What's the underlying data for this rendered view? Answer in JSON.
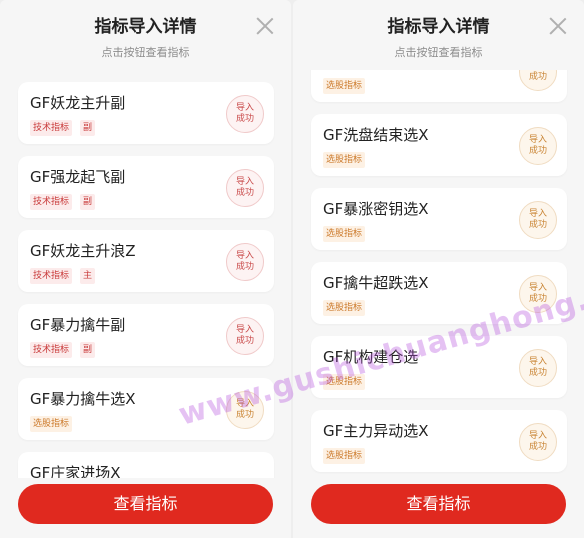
{
  "left": {
    "title": "指标导入详情",
    "subtitle": "点击按钮查看指标",
    "items": [
      {
        "name": "GF妖龙主升副",
        "tags": [
          "技术指标",
          "副"
        ],
        "tag_color": "red",
        "status": [
          "导入",
          "成功"
        ]
      },
      {
        "name": "GF强龙起飞副",
        "tags": [
          "技术指标",
          "副"
        ],
        "tag_color": "red",
        "status": [
          "导入",
          "成功"
        ]
      },
      {
        "name": "GF妖龙主升浪Z",
        "tags": [
          "技术指标",
          "主"
        ],
        "tag_color": "red",
        "status": [
          "导入",
          "成功"
        ]
      },
      {
        "name": "GF暴力擒牛副",
        "tags": [
          "技术指标",
          "副"
        ],
        "tag_color": "red",
        "status": [
          "导入",
          "成功"
        ]
      },
      {
        "name": "GF暴力擒牛选X",
        "tags": [
          "选股指标"
        ],
        "tag_color": "orange",
        "status": [
          "导入",
          "成功"
        ]
      },
      {
        "name": "GF庄家进场X",
        "tags": [],
        "tag_color": "orange",
        "status": []
      }
    ],
    "button": "查看指标"
  },
  "right": {
    "title": "指标导入详情",
    "subtitle": "点击按钮查看指标",
    "items": [
      {
        "name": "",
        "tags": [
          "选股指标"
        ],
        "tag_color": "orange",
        "status": [
          "导入",
          "成功"
        ]
      },
      {
        "name": "GF洗盘结束选X",
        "tags": [
          "选股指标"
        ],
        "tag_color": "orange",
        "status": [
          "导入",
          "成功"
        ]
      },
      {
        "name": "GF暴涨密钥选X",
        "tags": [
          "选股指标"
        ],
        "tag_color": "orange",
        "status": [
          "导入",
          "成功"
        ]
      },
      {
        "name": "GF擒牛超跌选X",
        "tags": [
          "选股指标"
        ],
        "tag_color": "orange",
        "status": [
          "导入",
          "成功"
        ]
      },
      {
        "name": "GF机构建仓选",
        "tags": [
          "选股指标"
        ],
        "tag_color": "orange",
        "status": [
          "导入",
          "成功"
        ]
      },
      {
        "name": "GF主力异动选X",
        "tags": [
          "选股指标"
        ],
        "tag_color": "orange",
        "status": [
          "导入",
          "成功"
        ]
      }
    ],
    "button": "查看指标"
  },
  "watermark": "www.gushichuanghong.com",
  "colors": {
    "accent": "#e0291f",
    "tag_red": "#c93b3b",
    "tag_orange": "#cc7a2b"
  }
}
